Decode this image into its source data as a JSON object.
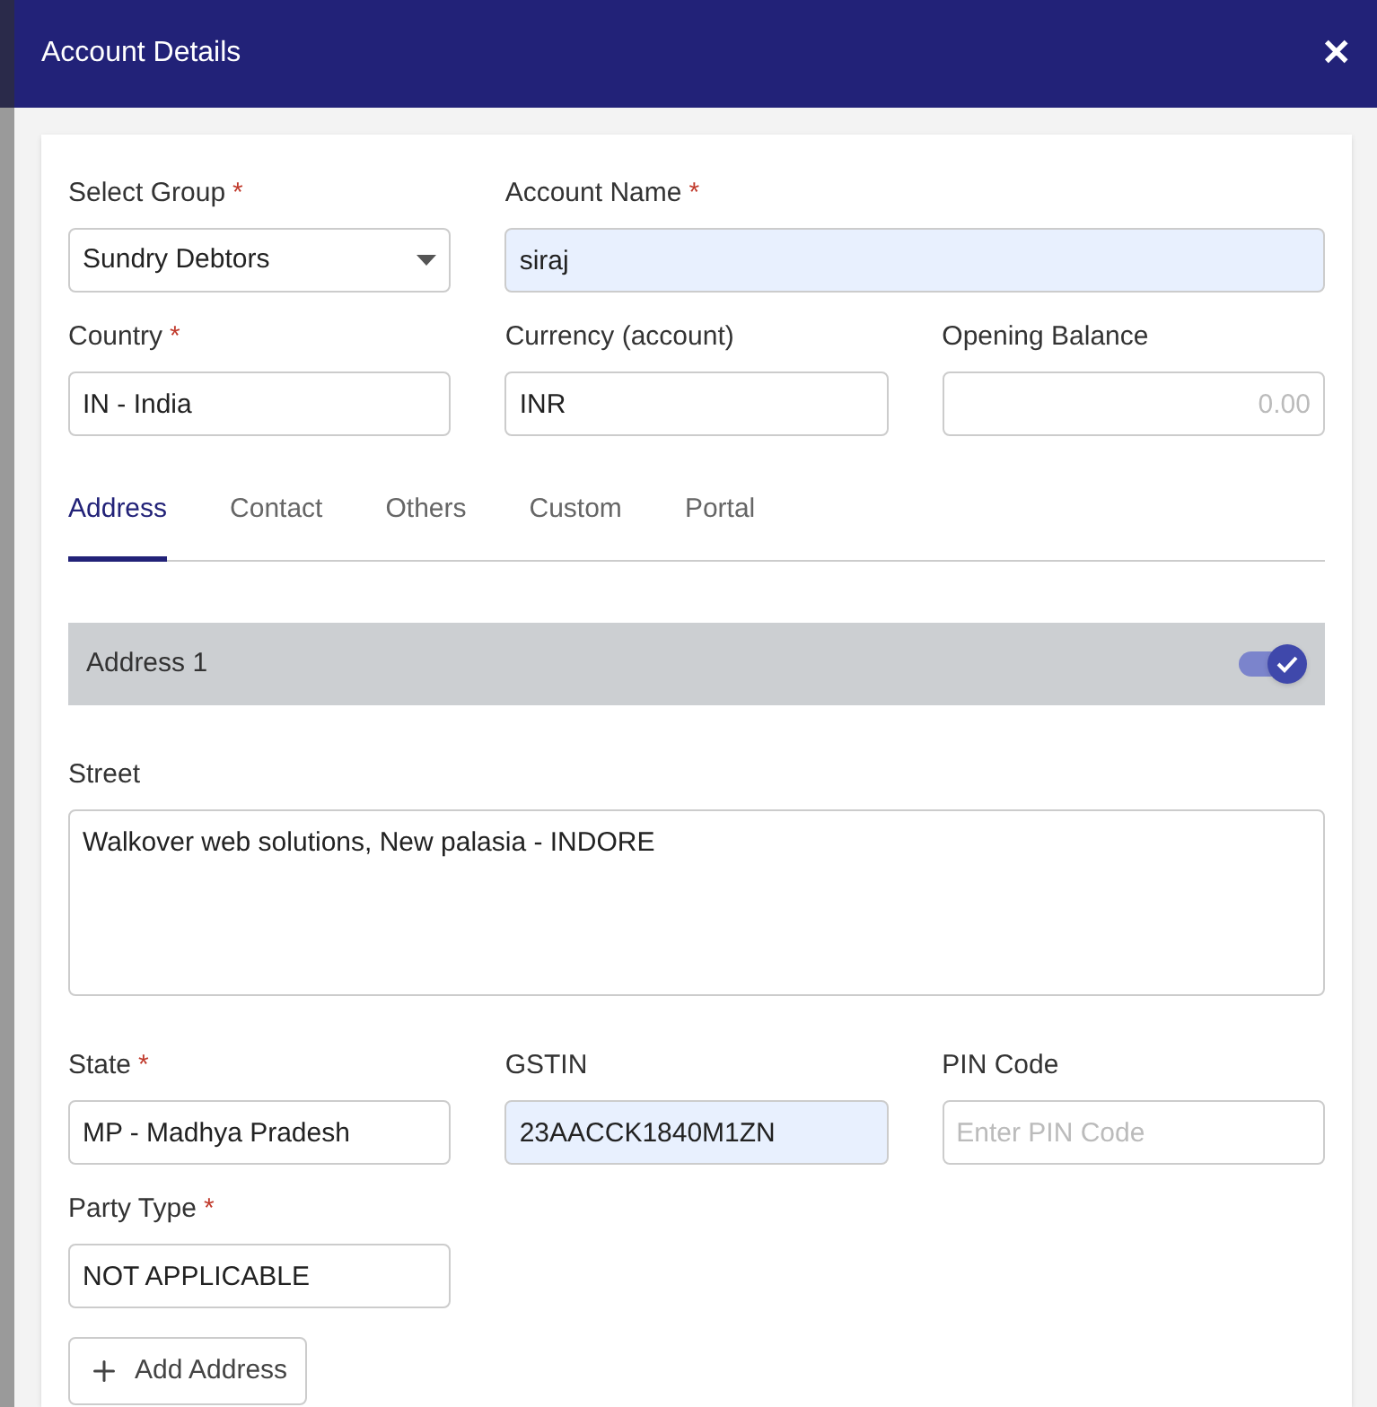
{
  "dialog": {
    "title": "Account Details",
    "close": "✕"
  },
  "top_fields": [
    {
      "label": "Select Group",
      "required_mark": "*",
      "kind": "select",
      "value": "Sundry Debtors",
      "highlighted": false
    },
    {
      "label": "Account Name",
      "required_mark": "*",
      "kind": "wide_text",
      "value": "siraj",
      "highlighted": true
    },
    {
      "label": "Country",
      "required_mark": "*",
      "kind": "text",
      "value": "IN - India",
      "highlighted": false
    },
    {
      "label": "Currency (account)",
      "kind": "text",
      "value": "INR",
      "highlighted": false
    },
    {
      "label": "Opening Balance",
      "kind": "number",
      "placeholder": "0.00",
      "highlighted": false
    }
  ],
  "tabs": [
    {
      "label": "Address",
      "selected": true
    },
    {
      "label": "Contact",
      "selected": false
    },
    {
      "label": "Others",
      "selected": false
    },
    {
      "label": "Custom",
      "selected": false
    },
    {
      "label": "Portal",
      "selected": false
    }
  ],
  "address": {
    "title": "Address 1",
    "enabled": true,
    "street": {
      "label": "Street",
      "value": "Walkover web solutions, New palasia - INDORE"
    },
    "fields": [
      {
        "label": "State",
        "required_mark": "*",
        "kind": "text",
        "value": "MP - Madhya Pradesh",
        "highlighted": false
      },
      {
        "label": "GSTIN",
        "kind": "text",
        "value": "23AACCK1840M1ZN",
        "highlighted": true
      },
      {
        "label": "PIN Code",
        "kind": "text",
        "placeholder": "Enter PIN Code",
        "highlighted": false
      },
      {
        "label": "Party Type",
        "required_mark": "*",
        "kind": "text",
        "value": "NOT APPLICABLE",
        "highlighted": false
      }
    ]
  },
  "add_button": "Add Address"
}
